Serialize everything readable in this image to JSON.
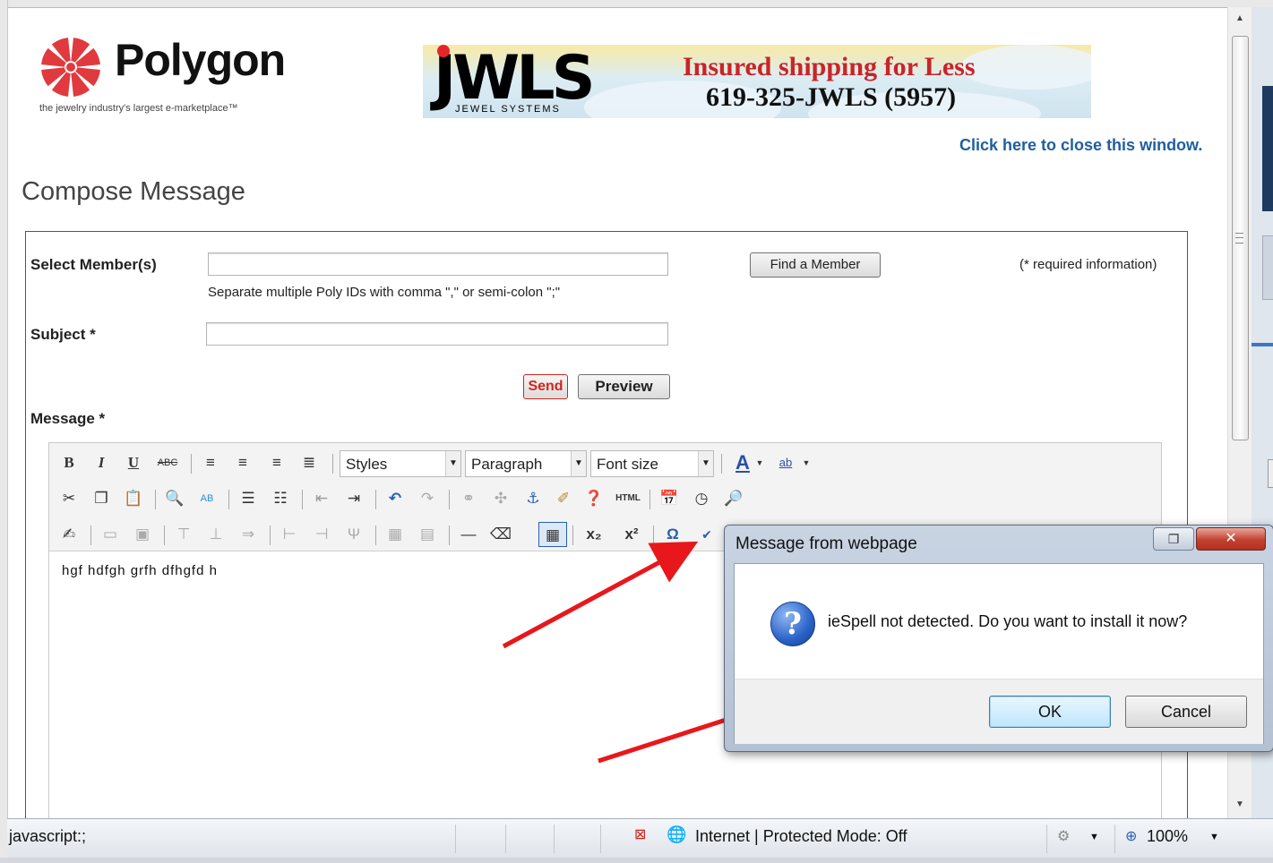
{
  "header": {
    "logo_name": "Polygon",
    "logo_tagline": "the jewelry industry's largest e-marketplace™",
    "banner": {
      "brand": "JWLS",
      "brand_sub": "JEWEL SYSTEMS",
      "line1": "Insured shipping for Less",
      "line2": "619-325-JWLS (5957)"
    },
    "close_link": "Click here to close this window."
  },
  "page": {
    "title": "Compose Message"
  },
  "form": {
    "members_label": "Select Member(s)",
    "members_value": "",
    "members_hint": "Separate multiple Poly IDs with comma \",\" or semi-colon \";\"",
    "find_member_button": "Find a Member",
    "required_note": "(* required information)",
    "subject_label": "Subject *",
    "subject_value": "",
    "send_button": "Send",
    "preview_button": "Preview",
    "message_label": "Message *"
  },
  "editor": {
    "styles_dropdown": "Styles",
    "format_dropdown": "Paragraph",
    "fontsize_dropdown": "Font size",
    "content": "hgf hdfgh grfh dfhgfd h"
  },
  "dialog": {
    "title": "Message from webpage",
    "message": "ieSpell not detected. Do you want to install it now?",
    "ok_button": "OK",
    "cancel_button": "Cancel"
  },
  "statusbar": {
    "left_text": "javascript:;",
    "zone_text": "Internet | Protected Mode: Off",
    "zoom_text": "100%"
  },
  "colors": {
    "link": "#1f5fa0",
    "send_text": "#d2261c",
    "annotation_arrow": "#e8171b"
  }
}
